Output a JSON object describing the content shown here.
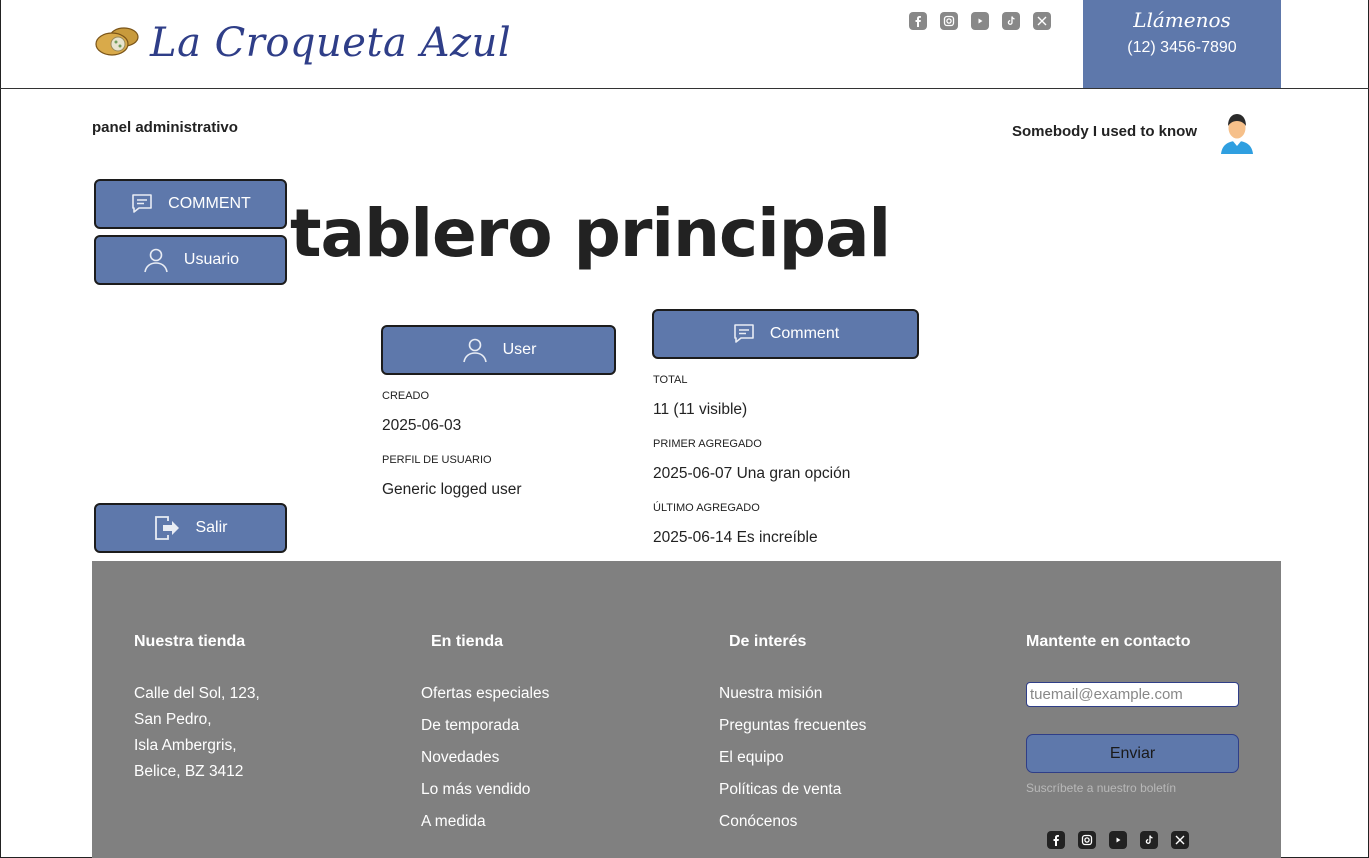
{
  "header": {
    "brand": "La Croqueta Azul",
    "social_icons": [
      "facebook-icon",
      "instagram-icon",
      "youtube-icon",
      "tiktok-icon",
      "x-icon"
    ],
    "call_title": "Llámenos",
    "call_phone": "(12) 3456-7890"
  },
  "admin": {
    "panel_label": "panel administrativo",
    "user_name": "Somebody I used to know"
  },
  "sidebar": {
    "comment_label": "COMMENT",
    "user_label": "Usuario",
    "logout_label": "Salir"
  },
  "main": {
    "title": "tablero principal",
    "user_card": {
      "button_label": "User",
      "created_label": "CREADO",
      "created_value": "2025-06-03",
      "profile_label": "PERFIL DE USUARIO",
      "profile_value": "Generic logged user"
    },
    "comment_card": {
      "button_label": "Comment",
      "total_label": "TOTAL",
      "total_value": "11 (11 visible)",
      "first_label": "PRIMER AGREGADO",
      "first_value": "2025-06-07 Una gran opción",
      "last_label": "ÚLTIMO AGREGADO",
      "last_value": "2025-06-14 Es increíble"
    }
  },
  "footer": {
    "store_heading": "Nuestra tienda",
    "store_address": [
      "Calle del Sol, 123,",
      "San Pedro,",
      "Isla Ambergris,",
      "Belice, BZ 3412"
    ],
    "shop_heading": "En tienda",
    "shop_links": [
      "Ofertas especiales",
      "De temporada",
      "Novedades",
      "Lo más vendido",
      "A medida"
    ],
    "interest_heading": "De interés",
    "interest_links": [
      "Nuestra misión",
      "Preguntas frecuentes",
      "El equipo",
      "Políticas de venta",
      "Conócenos"
    ],
    "contact_heading": "Mantente en contacto",
    "email_placeholder": "tuemail@example.com",
    "send_label": "Enviar",
    "newsletter_note": "Suscríbete a nuestro boletín"
  },
  "colors": {
    "accent": "#5e78ab",
    "brand_text": "#2f3e88",
    "footer_bg": "#808080"
  }
}
